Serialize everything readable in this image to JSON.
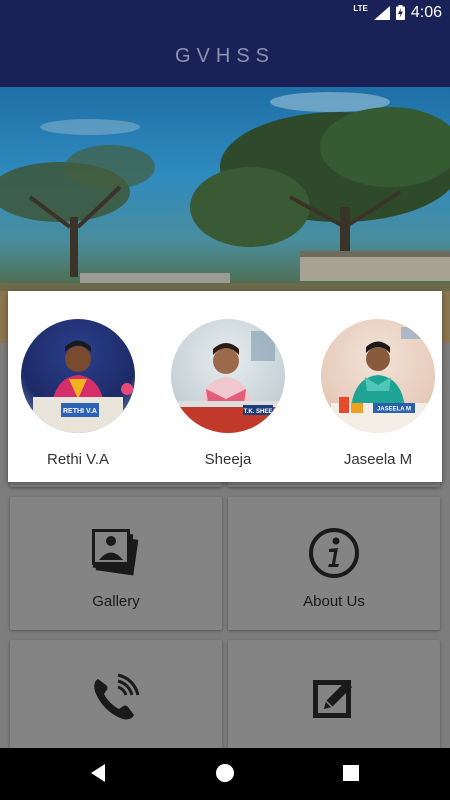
{
  "status_bar": {
    "network": "LTE",
    "time": "4:06"
  },
  "app_bar": {
    "title": "GVHSS"
  },
  "staff": [
    {
      "name": "Rethi V.A",
      "nameplate": "RETHI V.A"
    },
    {
      "name": "Sheeja",
      "nameplate": "T.K. SHEE"
    },
    {
      "name": "Jaseela M",
      "nameplate": "JASEELA M"
    }
  ],
  "tiles": [
    {
      "label": "Gallery",
      "icon": "photo-gallery-icon"
    },
    {
      "label": "About Us",
      "icon": "info-icon"
    },
    {
      "label": "",
      "icon": "phone-call-icon"
    },
    {
      "label": "",
      "icon": "edit-icon"
    }
  ],
  "nav": {
    "back": "back-icon",
    "home": "home-icon",
    "recents": "recents-icon"
  },
  "colors": {
    "primary": "#1a2156",
    "card": "#ffffff",
    "overlay": "#7d7d7d"
  }
}
